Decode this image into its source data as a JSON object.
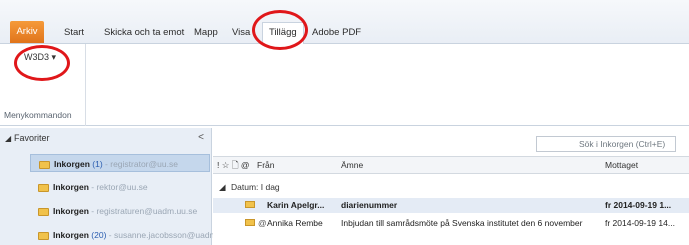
{
  "ribbon": {
    "tabs": [
      "Arkiv",
      "Start",
      "Skicka och ta emot",
      "Mapp",
      "Visa",
      "Tillägg",
      "Adobe PDF"
    ],
    "active_tab": "Tillägg",
    "w3d3_label": "W3D3 ▾",
    "group_label": "Menykommandon"
  },
  "nav": {
    "section_label": "Favoriter",
    "collapse_glyph": "<",
    "items": [
      {
        "name": "Inkorgen",
        "count": "(1)",
        "account": "- registrator@uu.se"
      },
      {
        "name": "Inkorgen",
        "count": "",
        "account": "- rektor@uu.se"
      },
      {
        "name": "Inkorgen",
        "count": "",
        "account": "- registraturen@uadm.uu.se"
      },
      {
        "name": "Inkorgen",
        "count": "(20)",
        "account": "- susanne.jacobsson@uadn"
      }
    ]
  },
  "mail": {
    "search_placeholder": "Sök i Inkorgen (Ctrl+E)",
    "columns": {
      "icons": "! ☆ 🗋 @",
      "from": "Från",
      "subject": "Ämne",
      "received": "Mottaget"
    },
    "group_header": "Datum: I dag",
    "rows": [
      {
        "from": "Karin Apelgr...",
        "subject": "diarienummer",
        "received": "fr 2014-09-19 1...",
        "unread": true
      },
      {
        "from": "Annika Rembe",
        "subject": "Inbjudan till samrådsmöte på Svenska institutet den 6 november",
        "received": "fr 2014-09-19 14...",
        "unread": false
      }
    ]
  },
  "colors": {
    "accent_file_tab": "#e0741b",
    "annotation": "#e0171a",
    "selection": "#c5d7ec"
  }
}
